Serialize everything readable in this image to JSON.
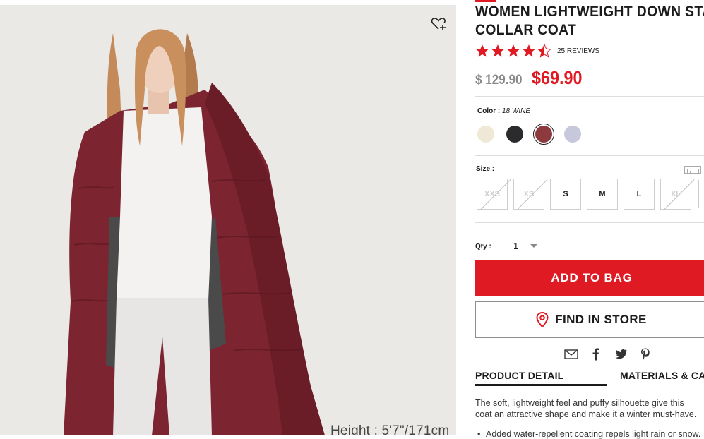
{
  "product": {
    "title_line1": "WOMEN LIGHTWEIGHT DOWN STAND",
    "title_line2": "COLLAR COAT",
    "rating": 4.5,
    "reviews_label": "25 REVIEWS",
    "original_price": "$ 129.90",
    "sale_price": "$69.90",
    "image_caption": "Height : 5'7\"/171cm"
  },
  "color": {
    "label": "Color :",
    "selected_name": "18 WINE",
    "swatches": [
      {
        "name": "cream",
        "hex": "#efe8d6"
      },
      {
        "name": "black",
        "hex": "#2b2b2d"
      },
      {
        "name": "wine",
        "hex": "#8c3a3e"
      },
      {
        "name": "lavender",
        "hex": "#c7c8dc"
      }
    ]
  },
  "size": {
    "label": "Size :",
    "options": [
      {
        "label": "XXS",
        "available": false
      },
      {
        "label": "XS",
        "available": false
      },
      {
        "label": "S",
        "available": true
      },
      {
        "label": "M",
        "available": true
      },
      {
        "label": "L",
        "available": true
      },
      {
        "label": "XL",
        "available": false
      }
    ]
  },
  "quantity": {
    "label": "Qty :",
    "value": "1"
  },
  "actions": {
    "add_to_bag": "ADD TO BAG",
    "find_in_store": "FIND IN STORE"
  },
  "share_icons": [
    "email-icon",
    "facebook-icon",
    "twitter-icon",
    "pinterest-icon"
  ],
  "tabs": [
    {
      "label": "PRODUCT DETAIL",
      "active": true
    },
    {
      "label": "MATERIALS & CARE",
      "active": false
    }
  ],
  "description": {
    "line1": "The soft, lightweight feel and puffy silhouette give this",
    "line2": "coat an attractive shape and make it a winter must-have.",
    "bullet1": "Added water-repellent coating repels light rain or snow."
  },
  "colors": {
    "brand_red": "#e01a22",
    "star_red": "#e01a22",
    "text": "#1b1b1b",
    "muted": "#8a8a8a"
  }
}
